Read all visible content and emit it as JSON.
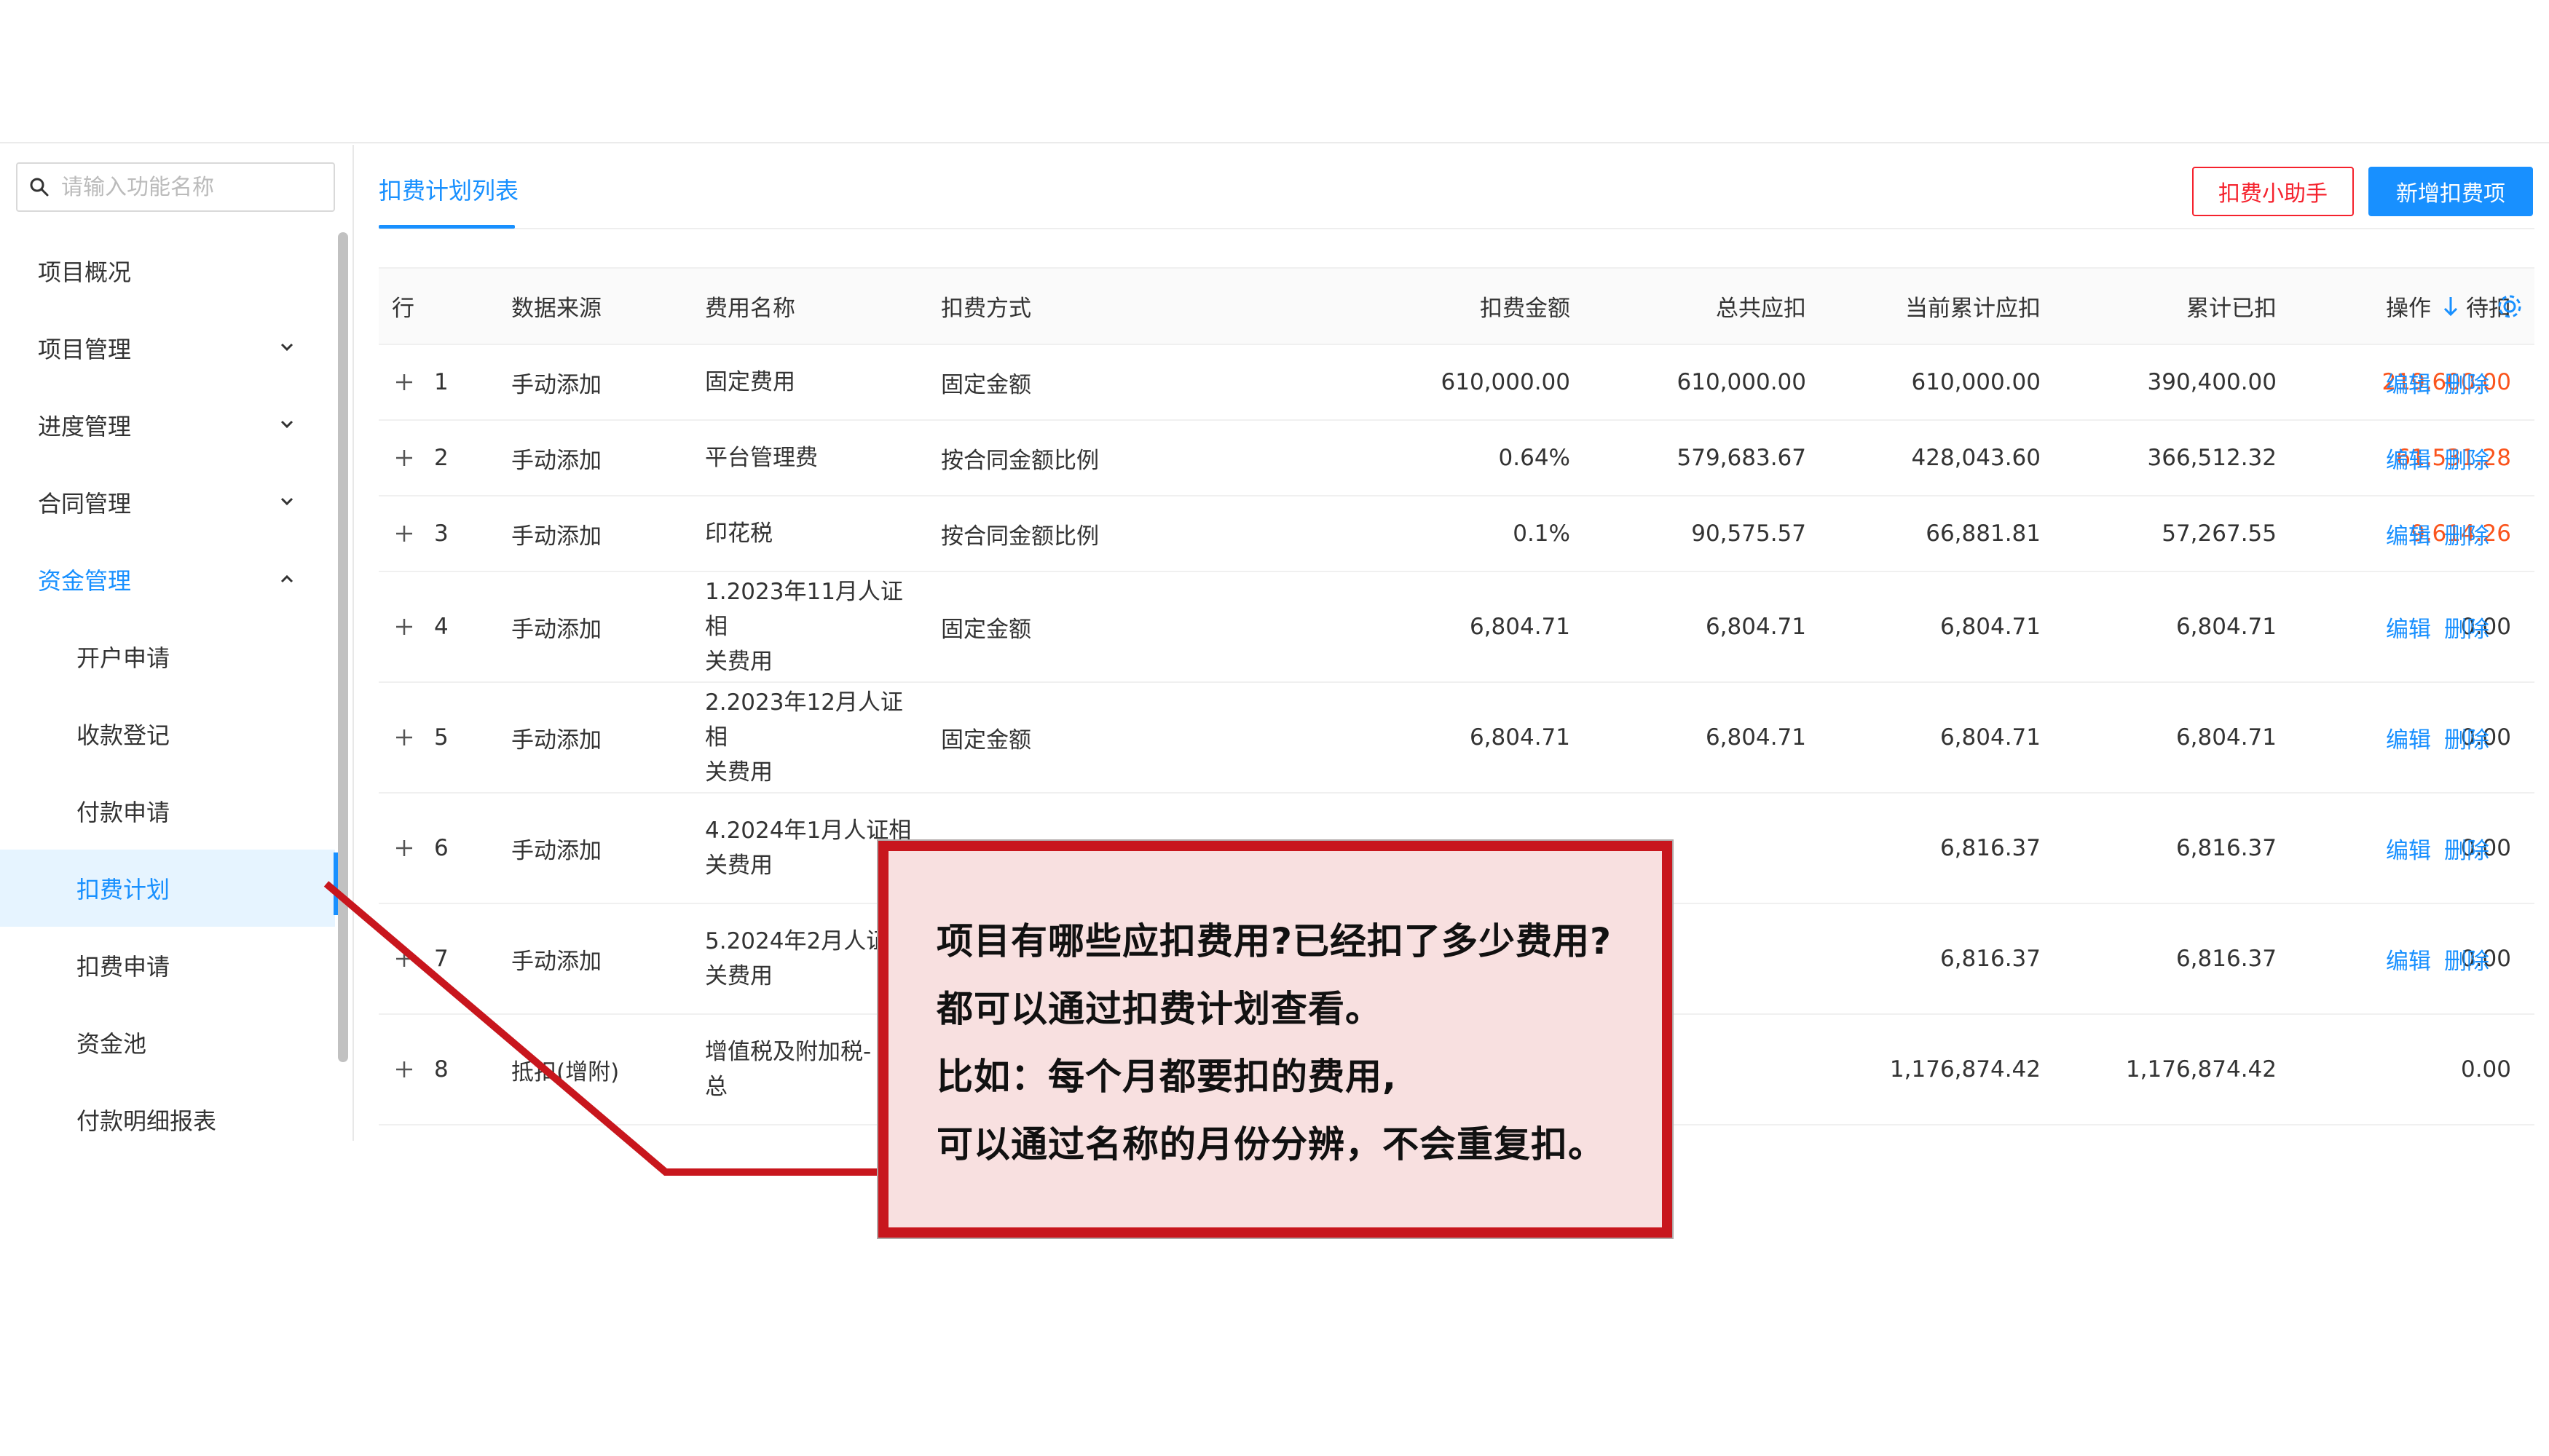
{
  "sidebar": {
    "search_placeholder": "请输入功能名称",
    "items": [
      {
        "label": "项目概况"
      },
      {
        "label": "项目管理"
      },
      {
        "label": "进度管理"
      },
      {
        "label": "合同管理"
      },
      {
        "label": "资金管理"
      },
      {
        "label": "开户申请"
      },
      {
        "label": "收款登记"
      },
      {
        "label": "付款申请"
      },
      {
        "label": "扣费计划"
      },
      {
        "label": "扣费申请"
      },
      {
        "label": "资金池"
      },
      {
        "label": "付款明细报表"
      }
    ]
  },
  "main": {
    "tab_label": "扣费计划列表",
    "helper_button": "扣费小助手",
    "add_button": "新增扣费项",
    "columns": {
      "row": "行",
      "source": "数据来源",
      "name": "费用名称",
      "method": "扣费方式",
      "amount": "扣费金额",
      "total_due": "总共应扣",
      "current_due": "当前累计应扣",
      "deducted": "累计已扣",
      "pending": "待扣",
      "actions": "操作"
    },
    "actions": {
      "edit": "编辑",
      "delete": "删除"
    },
    "rows": [
      {
        "no": "1",
        "source": "手动添加",
        "name1": "固定费用",
        "name2": "",
        "method": "固定金额",
        "amount": "610,000.00",
        "total_due": "610,000.00",
        "current_due": "610,000.00",
        "deducted": "390,400.00",
        "pending": "219,600.00"
      },
      {
        "no": "2",
        "source": "手动添加",
        "name1": "平台管理费",
        "name2": "",
        "method": "按合同金额比例",
        "amount": "0.64%",
        "total_due": "579,683.67",
        "current_due": "428,043.60",
        "deducted": "366,512.32",
        "pending": "61,531.28"
      },
      {
        "no": "3",
        "source": "手动添加",
        "name1": "印花税",
        "name2": "",
        "method": "按合同金额比例",
        "amount": "0.1%",
        "total_due": "90,575.57",
        "current_due": "66,881.81",
        "deducted": "57,267.55",
        "pending": "9,614.26"
      },
      {
        "no": "4",
        "source": "手动添加",
        "name1": "1.2023年11月人证相",
        "name2": "关费用",
        "method": "固定金额",
        "amount": "6,804.71",
        "total_due": "6,804.71",
        "current_due": "6,804.71",
        "deducted": "6,804.71",
        "pending": "0.00"
      },
      {
        "no": "5",
        "source": "手动添加",
        "name1": "2.2023年12月人证相",
        "name2": "关费用",
        "method": "固定金额",
        "amount": "6,804.71",
        "total_due": "6,804.71",
        "current_due": "6,804.71",
        "deducted": "6,804.71",
        "pending": "0.00"
      },
      {
        "no": "6",
        "source": "手动添加",
        "name1": "4.2024年1月人证相",
        "name2": "关费用",
        "method": "",
        "amount": "",
        "total_due": "",
        "current_due": "6,816.37",
        "deducted": "6,816.37",
        "pending": "0.00"
      },
      {
        "no": "7",
        "source": "手动添加",
        "name1": "5.2024年2月人证",
        "name2": "关费用",
        "method": "",
        "amount": "",
        "total_due": "",
        "current_due": "6,816.37",
        "deducted": "6,816.37",
        "pending": "0.00"
      },
      {
        "no": "8",
        "source": "抵扣(增附)",
        "name1": "增值税及附加税-",
        "name2": "总",
        "method": "",
        "amount": "",
        "total_due": "",
        "current_due": "1,176,874.42",
        "deducted": "1,176,874.42",
        "pending": "0.00"
      }
    ]
  },
  "callout": {
    "line1": "项目有哪些应扣费用?已经扣了多少费用?",
    "line2": "都可以通过扣费计划查看。",
    "line3": "比如：每个月都要扣的费用,",
    "line4": "可以通过名称的月份分辨，不会重复扣。"
  },
  "colors": {
    "accent": "#1890ff",
    "danger": "#f5222d",
    "pending_red": "#fa541c",
    "callout_border": "#c8161d",
    "callout_bg": "#f8e0e0"
  }
}
